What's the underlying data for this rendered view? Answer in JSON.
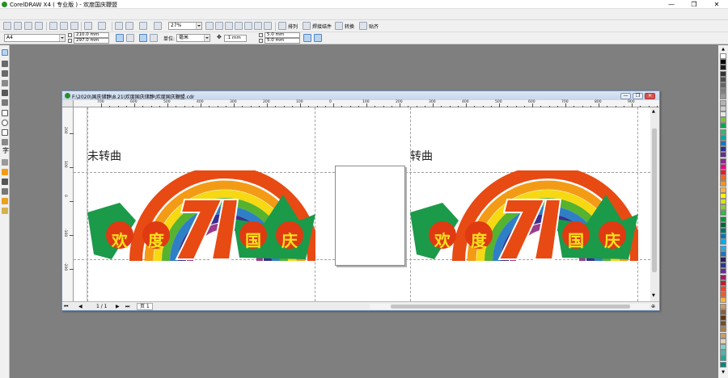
{
  "window": {
    "title": "CorelDRAW X4 ( 专业版 ) - 欢度国庆鞭盟",
    "controls": [
      "—",
      "❐",
      "✕"
    ]
  },
  "toolbar1": {
    "zoom": "27%",
    "buttons": [
      "排列",
      "焊接结件",
      "转换",
      "贴齐"
    ]
  },
  "toolbar2": {
    "page_size": "A4",
    "width": "210.0 mm",
    "height": "297.0 mm",
    "units_label": "单位:",
    "units": "毫米",
    "nudge": ".1 mm",
    "dup_x": "5.0 mm",
    "dup_y": "5.0 mm"
  },
  "document": {
    "title": "F:\\2020\\国庆储静\\8.21\\欢度国庆储静\\欢度国庆鞭盟.cdr",
    "controls": [
      "—",
      "❐",
      "✕"
    ],
    "ruler_labels": [
      "700",
      "600",
      "500",
      "400",
      "300",
      "200",
      "100",
      "0",
      "100",
      "200",
      "300",
      "400",
      "500",
      "600",
      "700",
      "800",
      "900"
    ],
    "ruler_v_labels": [
      "200",
      "100",
      "0",
      "-100",
      "-200"
    ],
    "left_caption": "未转曲",
    "right_caption": "转曲",
    "banner_chars": [
      "欢",
      "度",
      "国",
      "庆"
    ],
    "banner_number": "71"
  },
  "statusbar": {
    "page_indicator": "1 / 1",
    "page_tab": "页 1"
  },
  "colors": {
    "accent_blue": "#4f86c6",
    "rainbow": [
      "#e84a13",
      "#f49b16",
      "#f6d912",
      "#55b32f",
      "#2f7fc6",
      "#3a2e8f",
      "#9b3b8e"
    ],
    "leaf_green": "#1b9a4a",
    "lantern_red": "#e03a12",
    "char_yellow": "#f8e21a"
  },
  "palette": [
    "#ffffff",
    "#000000",
    "#1a1a1a",
    "#333333",
    "#4d4d4d",
    "#666666",
    "#808080",
    "#999999",
    "#b3b3b3",
    "#cccccc",
    "#e6e6e6",
    "#7fbf3f",
    "#00a651",
    "#3cb371",
    "#00a99d",
    "#1b75bc",
    "#2e3192",
    "#662d91",
    "#92278f",
    "#ec008c",
    "#ed1c24",
    "#f26522",
    "#f7941d",
    "#fbb040",
    "#fff200",
    "#d7df23",
    "#8dc63f",
    "#39b54a",
    "#009444",
    "#006838",
    "#00746b",
    "#0077b3",
    "#00aeef",
    "#27aae1",
    "#1c75bc",
    "#262262",
    "#2b3990",
    "#662d91",
    "#9e1f63",
    "#be1e2d",
    "#ef4136",
    "#f15a29",
    "#fbb03b",
    "#c49a6c",
    "#8b5e3c",
    "#603913",
    "#754c24",
    "#a97c50",
    "#c69c6d",
    "#e6d2b5",
    "#80cfc6",
    "#4db6ac",
    "#26a69a",
    "#00897b"
  ]
}
